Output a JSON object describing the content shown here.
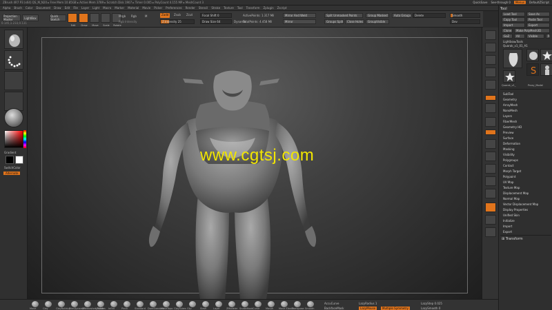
{
  "titlebar": {
    "info": "ZBrush 4R7 P3 (x64)  QS_M_N20  ▸ Free Mem 10.85GB ▸ Active Mem 3789 ▸ Scratch Disk 1907 ▸ Timer 0.005 ▸ PolyCount 4.155 MP ▸ MeshCount 3",
    "right_items": [
      "QuickSave",
      "See-through 0",
      "Menus",
      "DefaultZScript"
    ],
    "menus_active": "Menus"
  },
  "menubar": {
    "items": [
      "Alpha",
      "Brush",
      "Color",
      "Document",
      "Draw",
      "Edit",
      "File",
      "Layer",
      "Light",
      "Macro",
      "Marker",
      "Material",
      "Movie",
      "Picker",
      "Preferences",
      "Render",
      "Stencil",
      "Stroke",
      "Texture",
      "Tool",
      "Transform",
      "Zplugin",
      "Zscript"
    ]
  },
  "shelf": {
    "projection_master": "Projection Master",
    "lightbox": "LightBox",
    "quick_sketch": "Quick Sketch",
    "edit": "Edit",
    "draw": "Draw",
    "move": "Move",
    "scale": "Scale",
    "rotate": "Rotate",
    "mrgb": "Mrgb",
    "rgb": "Rgb",
    "m": "M",
    "rgb_intensity": "Rgb Intensity",
    "zadd": "Zadd",
    "zsub": "Zsub",
    "zcut": "Zcut",
    "z_intensity": "Z Intensity 25",
    "focal_shift": "Focal Shift 0",
    "draw_size": "Draw Size 64",
    "dynamic": "Dynamic",
    "active_points": "ActivePoints: 1.317 Mil",
    "total_points": "TotalPoints: 4.458 Mil",
    "mirror_weld": "Mirror And Weld",
    "mirror": "Mirror",
    "split_unmasked": "Split Unmasked Points",
    "groups_split": "Groups Split",
    "close_holes": "Close Holes",
    "group_visible": "GroupVisible",
    "group_masked": "Group Masked",
    "auto_groups": "Auto Groups",
    "delete": "Delete",
    "smooth": "Smooth",
    "dev": "Dev"
  },
  "leftpanel": {
    "gradient": "Gradient",
    "switch_color": "SwitchColor",
    "alternate": "Alternate",
    "coords": "0.145,1.233,0.131"
  },
  "canvas": {
    "watermark": "www.cgtsj.com"
  },
  "rightpanel": {
    "title": "Tool",
    "buttons": [
      "Load Tool",
      "Save As",
      "Copy Tool",
      "Paste Tool",
      "Import",
      "Export",
      "Clone",
      "Make PolyMesh3D",
      "GoZ",
      "All",
      "Visible",
      "R"
    ],
    "lightbox_tools": "Lightbox▸Tools",
    "current_tool": "Quarak_v1_01_A1",
    "thumb_labels": [
      "Quarak_v1_01",
      "PolyMesh3D",
      "SimpleBrush",
      "Quarak_v1_",
      "Proxy_Model"
    ],
    "sections": [
      "SubTool",
      "Geometry",
      "ArrayMesh",
      "NanoMesh",
      "Layers",
      "FiberMesh",
      "Geometry HD",
      "Preview",
      "Surface",
      "Deformation",
      "Masking",
      "Visibility",
      "Polygroups",
      "Contact",
      "Morph Target",
      "Polypaint",
      "UV Map",
      "Texture Map",
      "Displacement Map",
      "Normal Map",
      "Vector Displacement Map",
      "Display Properties",
      "Unified Skin",
      "Initialize",
      "Import",
      "Export"
    ],
    "transform_title": "Transform"
  },
  "bottombar": {
    "brushes": [
      "Move",
      "Clay",
      "ClayBuildup",
      "TrimDynamic",
      "ZRemesher_Guides",
      "hPolish",
      "Inflat",
      "Pinch",
      "Standard",
      "DamStandard",
      "MoveTopo",
      "ClayTubes",
      "Clip",
      "Slash",
      "Layer",
      "ZModeler",
      "SnakeHook",
      "Curve",
      "Morph",
      "Move Elastic",
      "Transpose",
      "Smooth"
    ],
    "accucurve": "AccuCurve",
    "backface_mask": "BackfaceMask",
    "lazy_radius": "LazyRadius 1",
    "lazy_mouse": "LazyMouse",
    "lazy_step": "LazyStep 0.025",
    "lazy_smooth": "LazySmooth 0",
    "multiple_symmetry": "Multiple Symmetry"
  }
}
